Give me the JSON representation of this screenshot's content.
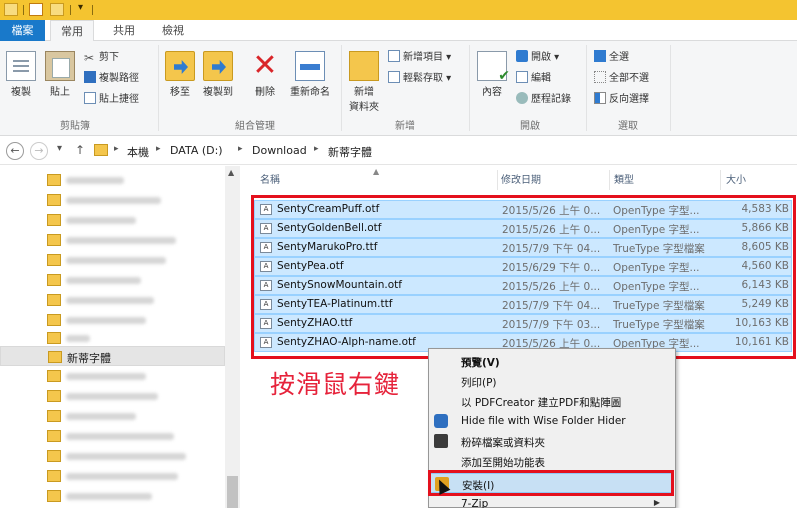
{
  "ribbon_tabs": [
    "檔案",
    "常用",
    "共用",
    "檢視"
  ],
  "ribbon": {
    "clipboard": {
      "copy": "複製",
      "paste": "貼上",
      "cut": "剪下",
      "copy_path": "複製路徑",
      "paste_shortcut": "貼上捷徑",
      "group": "剪貼簿"
    },
    "organize": {
      "move_to": "移至",
      "copy_to": "複製到",
      "delete": "刪除",
      "rename": "重新命名",
      "group": "組合管理"
    },
    "new": {
      "new_folder_line1": "新增",
      "new_folder_line2": "資料夾",
      "new_item": "新增項目 ▾",
      "easy_access": "輕鬆存取 ▾",
      "group": "新增"
    },
    "open": {
      "properties": "內容",
      "open": "開啟 ▾",
      "edit": "編輯",
      "history": "歷程記錄",
      "group": "開啟"
    },
    "select": {
      "select_all": "全選",
      "select_none": "全部不選",
      "invert": "反向選擇",
      "group": "選取"
    }
  },
  "address": {
    "crumbs": [
      "本機",
      "DATA (D:)",
      "Download",
      "新蒂字體"
    ]
  },
  "nav_pane": {
    "selected_folder": "新蒂字體"
  },
  "columns": {
    "name": "名稱",
    "date": "修改日期",
    "type": "類型",
    "size": "大小"
  },
  "files": [
    {
      "name": "SentyCreamPuff.otf",
      "date": "2015/5/26 上午 0...",
      "type": "OpenType 字型...",
      "size": "4,583 KB"
    },
    {
      "name": "SentyGoldenBell.otf",
      "date": "2015/5/26 上午 0...",
      "type": "OpenType 字型...",
      "size": "5,866 KB"
    },
    {
      "name": "SentyMarukoPro.ttf",
      "date": "2015/7/9 下午 04...",
      "type": "TrueType 字型檔案",
      "size": "8,605 KB"
    },
    {
      "name": "SentyPea.otf",
      "date": "2015/6/29 下午 0...",
      "type": "OpenType 字型...",
      "size": "4,560 KB"
    },
    {
      "name": "SentySnowMountain.otf",
      "date": "2015/5/26 上午 0...",
      "type": "OpenType 字型...",
      "size": "6,143 KB"
    },
    {
      "name": "SentyTEA-Platinum.ttf",
      "date": "2015/7/9 下午 04...",
      "type": "TrueType 字型檔案",
      "size": "5,249 KB"
    },
    {
      "name": "SentyZHAO.ttf",
      "date": "2015/7/9 下午 03...",
      "type": "TrueType 字型檔案",
      "size": "10,163 KB"
    },
    {
      "name": "SentyZHAO-Alph-name.otf",
      "date": "2015/5/26 上午 0...",
      "type": "OpenType 字型...",
      "size": "10,161 KB"
    }
  ],
  "annotation": "按滑鼠右鍵",
  "context_menu": {
    "preview": "預覽(V)",
    "print": "列印(P)",
    "pdf": "以 PDFCreator 建立PDF和點陣圖",
    "hide": "Hide file with Wise Folder Hider",
    "shred": "粉碎檔案或資料夾",
    "pin": "添加至開始功能表",
    "install": "安裝(I)",
    "zip": "7-Zip"
  },
  "colors": {
    "accent": "#1979ca",
    "title_bar": "#f4c430",
    "selection": "#cce8ff",
    "highlight_box": "#e4101d",
    "annotation_text": "#e6233b"
  }
}
